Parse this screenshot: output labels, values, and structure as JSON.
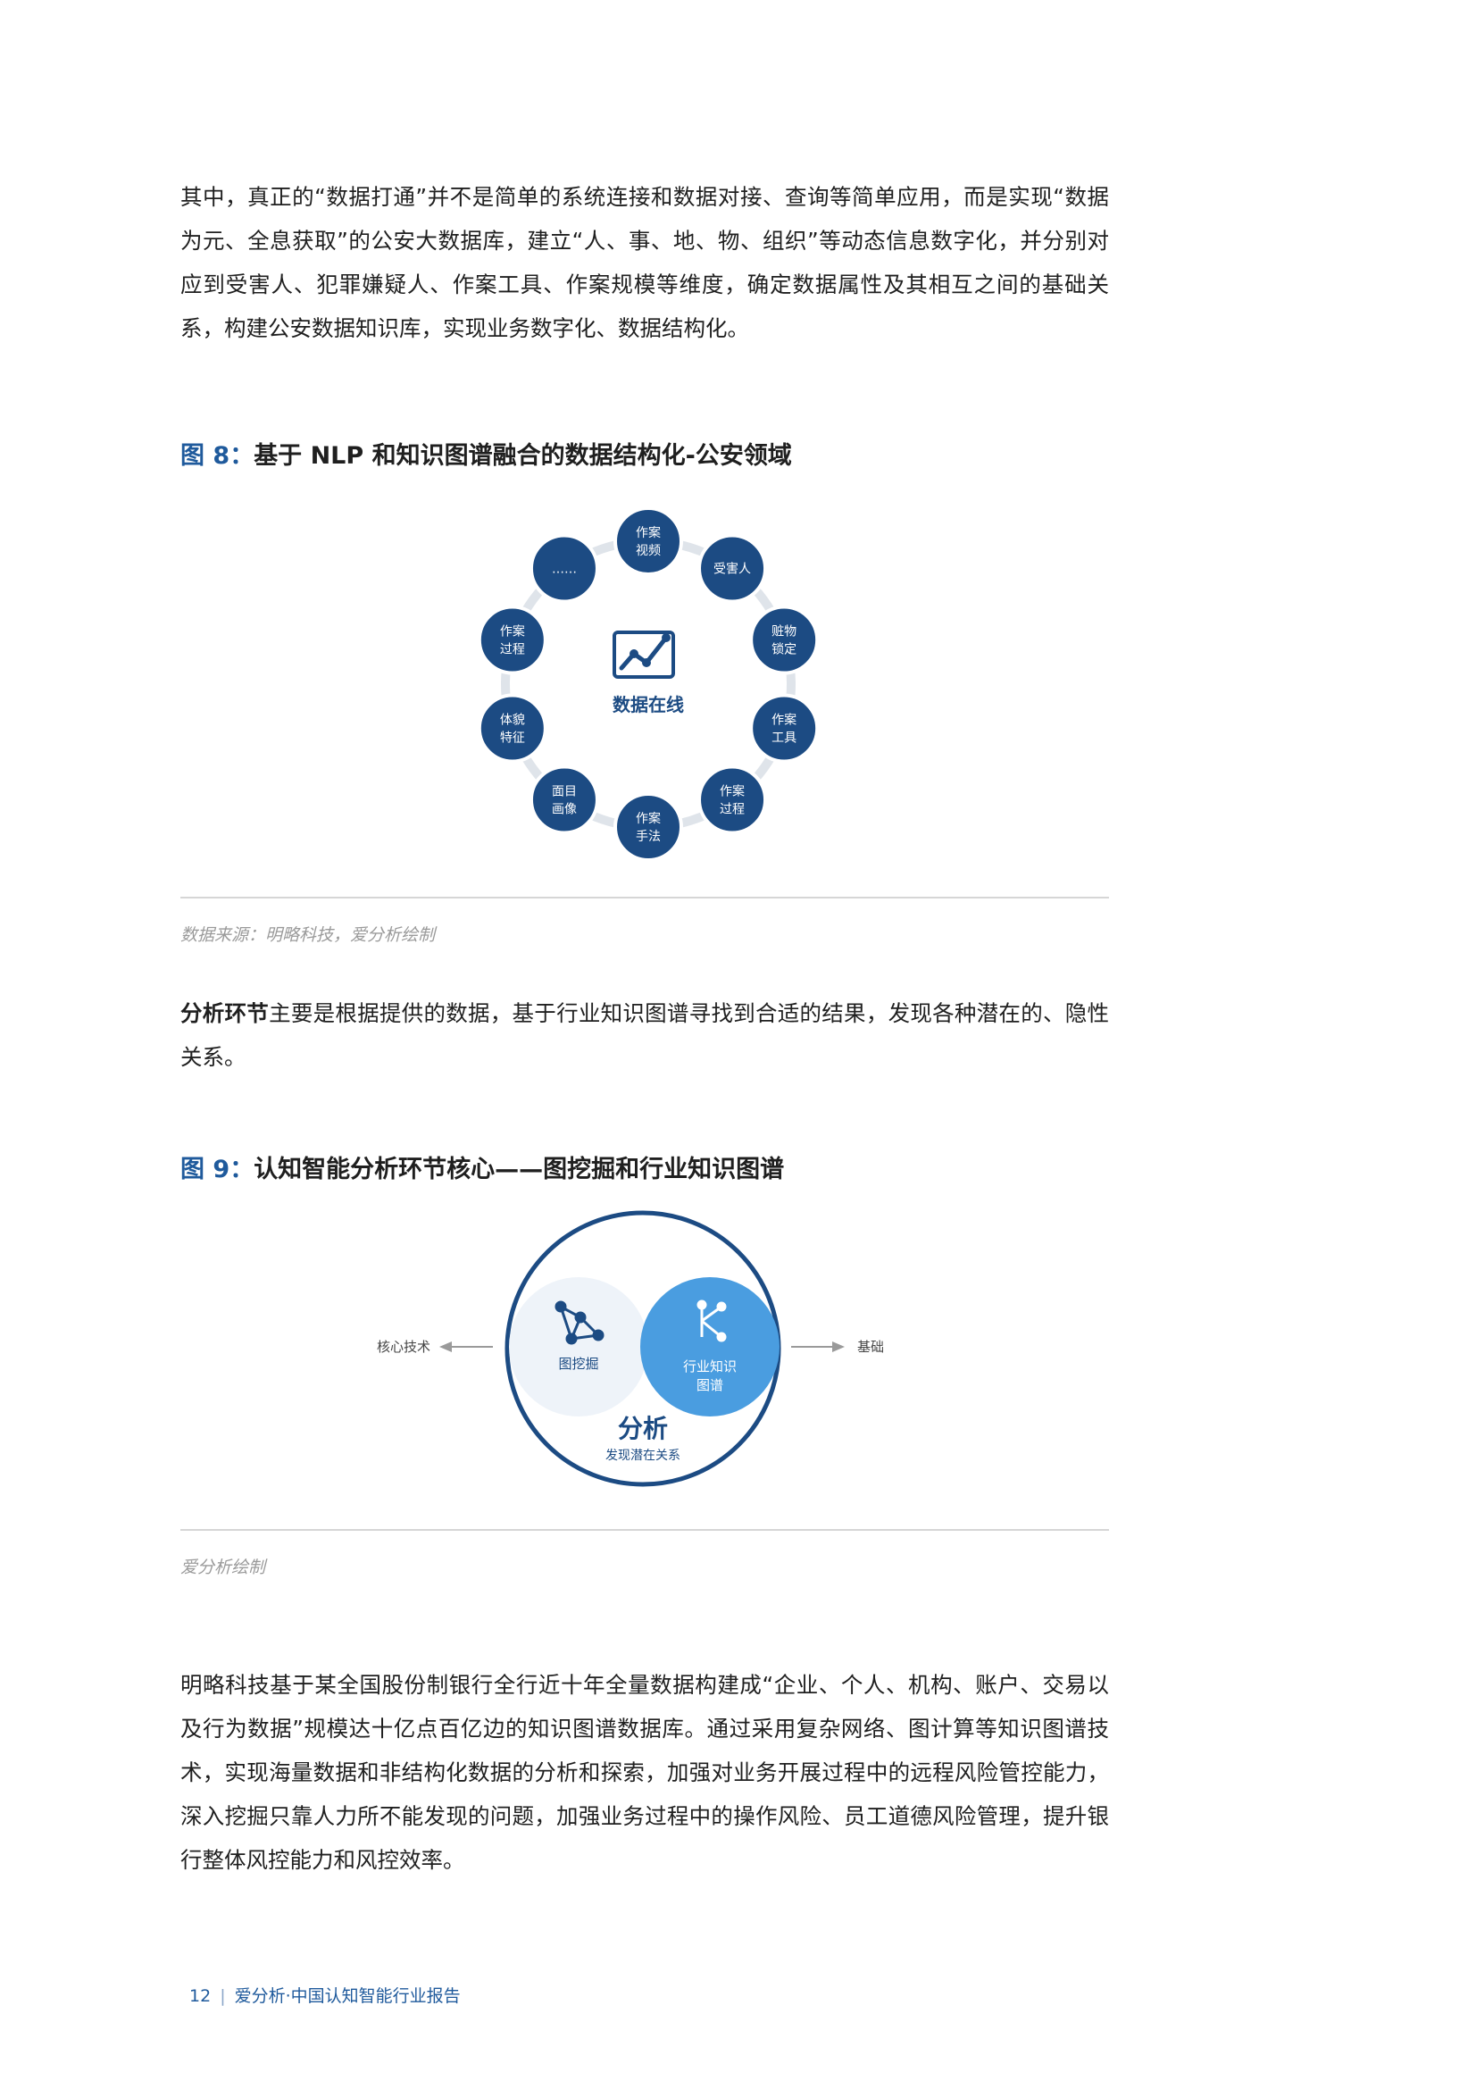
{
  "paragraph1": "其中，真正的“数据打通”并不是简单的系统连接和数据对接、查询等简单应用，而是实现“数据为元、全息获取”的公安大数据库，建立“人、事、地、物、组织”等动态信息数字化，并分别对应到受害人、犯罪嫌疑人、作案工具、作案规模等维度，确定数据属性及其相互之间的基础关系，构建公安数据知识库，实现业务数字化、数据结构化。",
  "figure8": {
    "num": "图 8",
    "colon": "：",
    "title": "基于 NLP 和知识图谱融合的数据结构化-公安领域",
    "center_label": "数据在线",
    "nodes": [
      [
        "作案",
        "视频"
      ],
      [
        "受害人"
      ],
      [
        "赃物",
        "锁定"
      ],
      [
        "作案",
        "工具"
      ],
      [
        "作案",
        "过程"
      ],
      [
        "作案",
        "手法"
      ],
      [
        "面目",
        "画像"
      ],
      [
        "体貌",
        "特征"
      ],
      [
        "作案",
        "过程"
      ],
      [
        "……"
      ]
    ],
    "source": "数据来源：明略科技，爱分析绘制",
    "colors": {
      "node": "#1c4b83",
      "ring": "#dfe4ea",
      "icon": "#1c4b83"
    }
  },
  "paragraph2": {
    "bold": "分析环节",
    "rest": "主要是根据提供的数据，基于行业知识图谱寻找到合适的结果，发现各种潜在的、隐性关系。"
  },
  "figure9": {
    "num": "图 9",
    "colon": "：",
    "title": "认知智能分析环节核心——图挖掘和行业知识图谱",
    "left_label": "核心技术",
    "right_label": "基础",
    "left_circle_label": "图挖掘",
    "right_circle_label": [
      "行业知识",
      "图谱"
    ],
    "main_label": "分析",
    "sub_label": "发现潜在关系",
    "source": "爱分析绘制",
    "colors": {
      "outer": "#1c4b83",
      "light": "#eef3f9",
      "accent": "#4a9de0"
    }
  },
  "paragraph3": "明略科技基于某全国股份制银行全行近十年全量数据构建成“企业、个人、机构、账户、交易以及行为数据”规模达十亿点百亿边的知识图谱数据库。通过采用复杂网络、图计算等知识图谱技术，实现海量数据和非结构化数据的分析和探索，加强对业务开展过程中的远程风险管控能力，深入挖掘只靠人力所不能发现的问题，加强业务过程中的操作风险、员工道德风险管理，提升银行整体风控能力和风控效率。",
  "footer": {
    "page": "12",
    "separator": "|",
    "title": "爱分析·中国认知智能行业报告"
  }
}
